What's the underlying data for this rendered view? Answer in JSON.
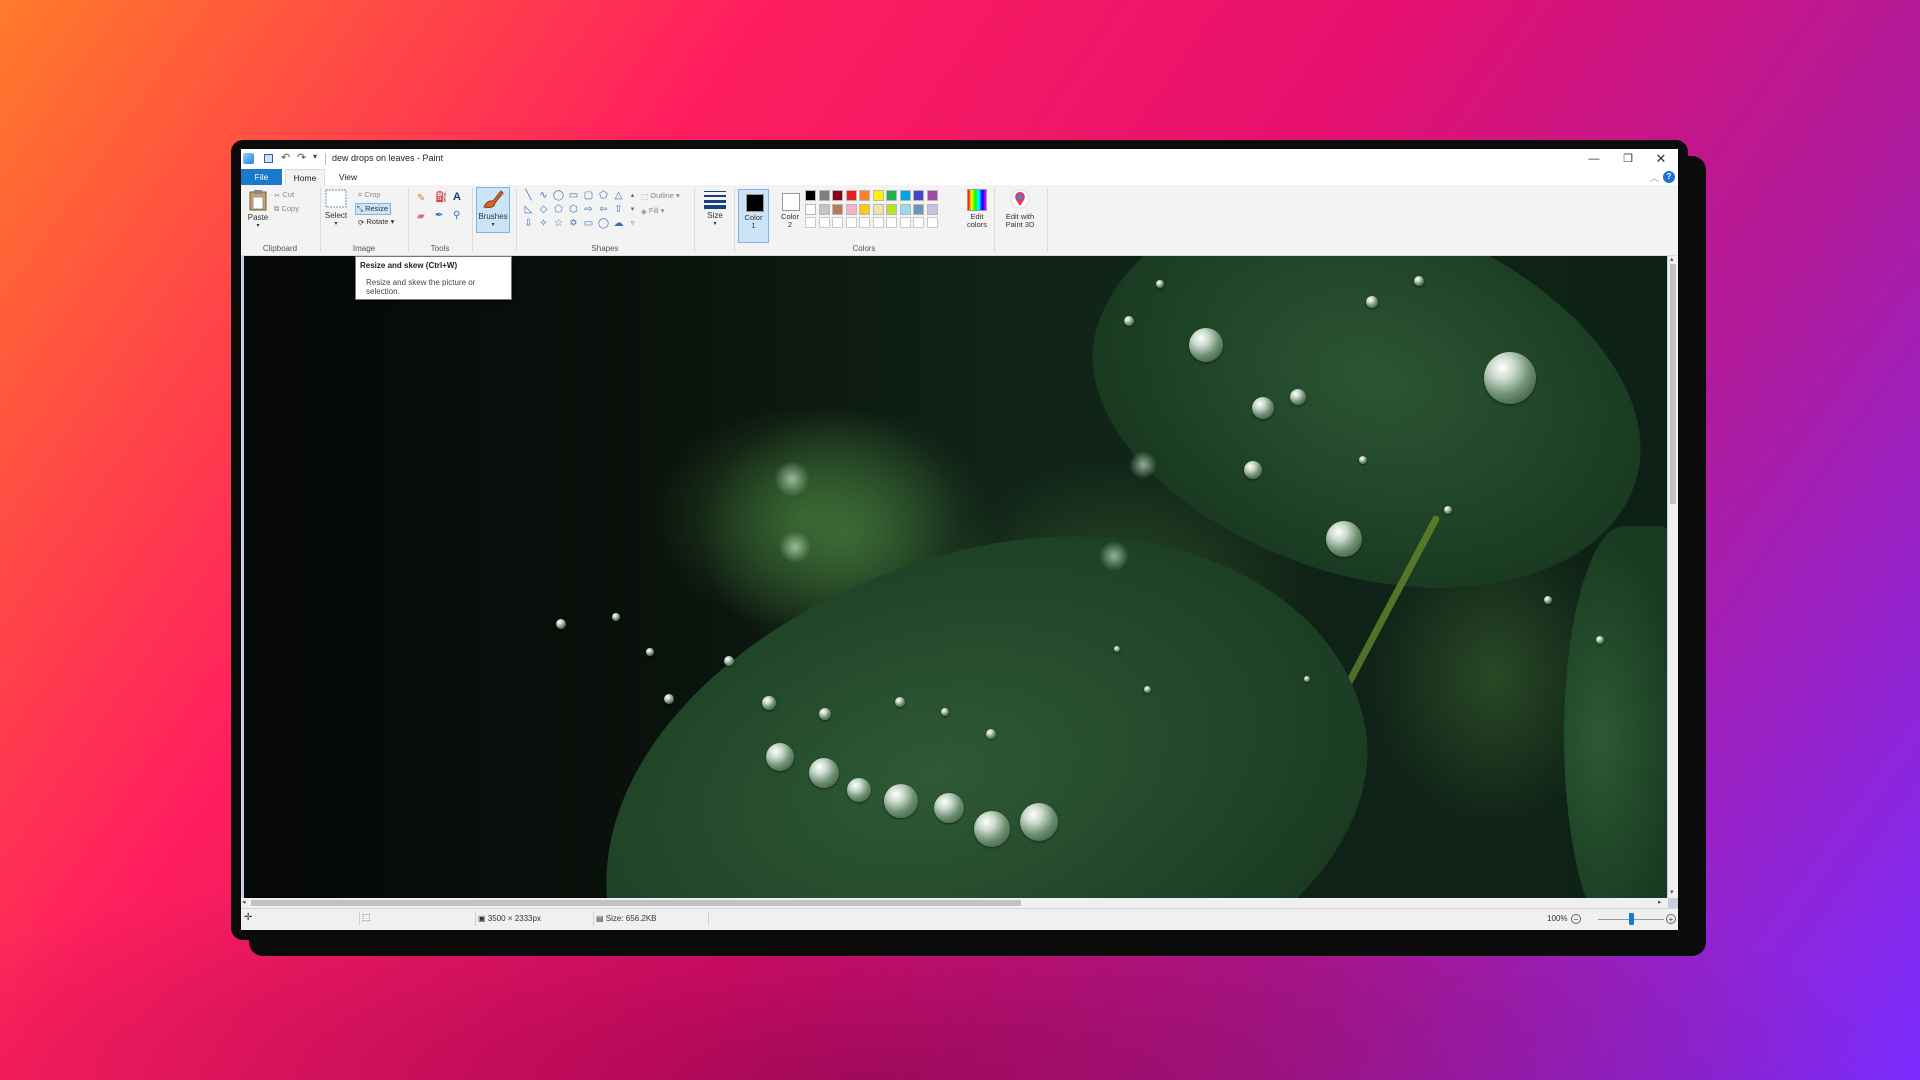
{
  "window": {
    "title": "dew drops on leaves - Paint",
    "min": "—",
    "max": "❐",
    "close": "✕"
  },
  "menu": {
    "file": "File",
    "home": "Home",
    "view": "View"
  },
  "ribbon": {
    "clipboard": {
      "paste": "Paste",
      "cut": "Cut",
      "copy": "Copy",
      "label": "Clipboard"
    },
    "image": {
      "select": "Select",
      "crop": "Crop",
      "resize": "Resize",
      "rotate": "Rotate",
      "label": "Image"
    },
    "tools": {
      "label": "Tools"
    },
    "brushes": {
      "label": "Brushes"
    },
    "shapes": {
      "outline": "Outline",
      "fill": "Fill",
      "label": "Shapes"
    },
    "size": {
      "label": "Size"
    },
    "colors": {
      "color1_line1": "Color",
      "color1_line2": "1",
      "color2_line1": "Color",
      "color2_line2": "2",
      "edit_line1": "Edit",
      "edit_line2": "colors",
      "label": "Colors",
      "palette_row1": [
        "#000000",
        "#7f7f7f",
        "#880015",
        "#ed1c24",
        "#ff7f27",
        "#fff200",
        "#22b14c",
        "#00a2e8",
        "#3f48cc",
        "#a349a4"
      ],
      "palette_row2": [
        "#ffffff",
        "#c3c3c3",
        "#b97a57",
        "#ffaec9",
        "#ffc90e",
        "#efe4b0",
        "#b5e61d",
        "#99d9ea",
        "#7092be",
        "#c8bfe7"
      ]
    },
    "paint3d": {
      "line1": "Edit with",
      "line2": "Paint 3D"
    }
  },
  "tooltip": {
    "title": "Resize and skew (Ctrl+W)",
    "body": "Resize and skew the picture or selection."
  },
  "status": {
    "dimensions": "3500 × 2333px",
    "size": "Size: 656.2KB",
    "zoom": "100%"
  }
}
